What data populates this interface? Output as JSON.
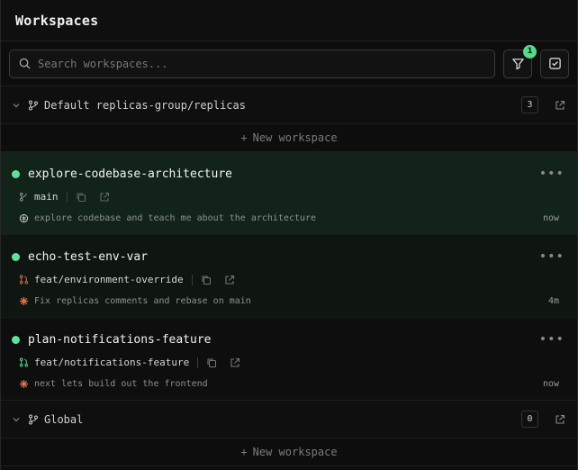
{
  "header": {
    "title": "Workspaces"
  },
  "search": {
    "placeholder": "Search workspaces..."
  },
  "filter": {
    "badge": "1"
  },
  "groups": [
    {
      "name": "Default replicas-group/replicas",
      "count": "3",
      "new_label": "New workspace",
      "workspaces": [
        {
          "title": "explore-codebase-architecture",
          "branch": "main",
          "desc": "explore codebase and teach me about the architecture",
          "time": "now",
          "status": "active"
        },
        {
          "title": "echo-test-env-var",
          "branch": "feat/environment-override",
          "desc": "Fix replicas comments and rebase on main",
          "time": "4m",
          "status": "idle"
        },
        {
          "title": "plan-notifications-feature",
          "branch": "feat/notifications-feature",
          "desc": "next lets build out the frontend",
          "time": "now",
          "status": "idle"
        }
      ]
    },
    {
      "name": "Global",
      "count": "0",
      "new_label": "New workspace",
      "workspaces": []
    }
  ],
  "colors": {
    "accent": "#57d98b",
    "active_bg": "#122419",
    "orange": "#e8734a"
  }
}
